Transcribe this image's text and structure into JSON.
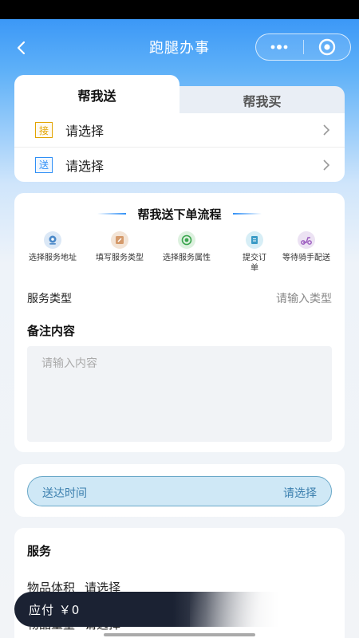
{
  "nav": {
    "title": "跑腿办事"
  },
  "tabs": [
    {
      "label": "帮我送",
      "active": true
    },
    {
      "label": "帮我买",
      "active": false
    }
  ],
  "address": [
    {
      "tag": "接",
      "label": "请选择"
    },
    {
      "tag": "送",
      "label": "请选择"
    }
  ],
  "flow": {
    "title": "帮我送下单流程",
    "steps": [
      {
        "label": "选择服务地址",
        "icon": "location-icon"
      },
      {
        "label": "填写服务类型",
        "icon": "edit-form-icon"
      },
      {
        "label": "选择服务属性",
        "icon": "target-icon"
      },
      {
        "label": "提交订单",
        "icon": "document-icon"
      },
      {
        "label": "等待骑手配送",
        "icon": "scooter-icon"
      }
    ]
  },
  "service_type": {
    "label": "服务类型",
    "placeholder": "请输入类型"
  },
  "remark": {
    "title": "备注内容",
    "placeholder": "请输入内容"
  },
  "delivery_time": {
    "label": "送达时间",
    "value": "请选择"
  },
  "services": {
    "title": "服务",
    "rows": [
      {
        "label": "物品体积",
        "value": "请选择"
      },
      {
        "label": "物品重量",
        "value": "请选择"
      }
    ]
  },
  "payment": {
    "label": "应付",
    "amount": "￥0"
  },
  "colors": {
    "primary": "#2f8ff6",
    "dark_bar": "#1b2233",
    "tag_pickup": "#e2a400"
  }
}
